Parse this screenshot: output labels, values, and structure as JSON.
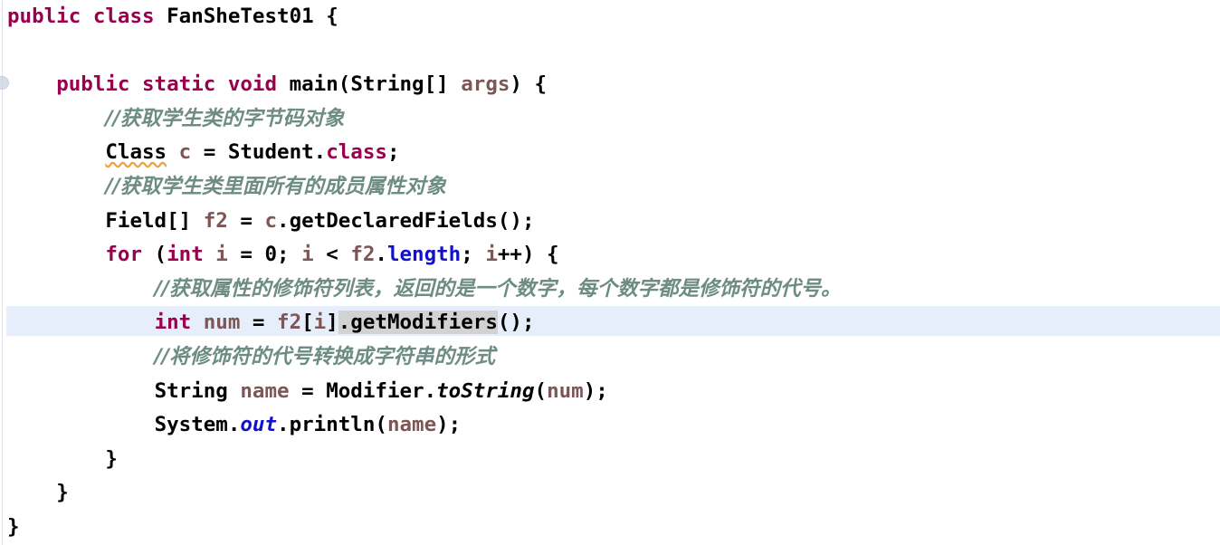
{
  "editor": {
    "language": "java",
    "class_name": "FanSheTest01",
    "font_size_px": 22,
    "line_height_px": 37,
    "background_color": "#ffffff",
    "caret_line_highlight_color": "#e7eefb",
    "usage_highlight_color": "#d2d2d2",
    "warning_squiggle_color": "#e8a33d",
    "gutter_marker": "breakpoint-gutter-icon",
    "highlighted_line_number": 10,
    "highlighted_token": ".getModifiers"
  },
  "palette": {
    "keyword": "#99004D",
    "comment": "#6D8C84",
    "identifier": "#7D5656",
    "static_field": "#1111CC",
    "instance_field": "#1111CC",
    "plain": "#000000"
  },
  "lines": [
    {
      "n": 1,
      "indent": 0,
      "tokens": [
        {
          "t": "public",
          "c": "kw"
        },
        {
          "t": " ",
          "c": "plain"
        },
        {
          "t": "class",
          "c": "kw"
        },
        {
          "t": " ",
          "c": "plain"
        },
        {
          "t": "FanSheTest01",
          "c": "plain"
        },
        {
          "t": " {",
          "c": "plain"
        }
      ]
    },
    {
      "n": 2,
      "indent": 0,
      "tokens": []
    },
    {
      "n": 3,
      "indent": 1,
      "tokens": [
        {
          "t": "public",
          "c": "kw"
        },
        {
          "t": " ",
          "c": "plain"
        },
        {
          "t": "static",
          "c": "kw"
        },
        {
          "t": " ",
          "c": "plain"
        },
        {
          "t": "void",
          "c": "kw"
        },
        {
          "t": " ",
          "c": "plain"
        },
        {
          "t": "main",
          "c": "plain"
        },
        {
          "t": "(",
          "c": "plain"
        },
        {
          "t": "String",
          "c": "plain"
        },
        {
          "t": "[] ",
          "c": "plain"
        },
        {
          "t": "args",
          "c": "id"
        },
        {
          "t": ") {",
          "c": "plain"
        }
      ]
    },
    {
      "n": 4,
      "indent": 2,
      "tokens": [
        {
          "t": "//获取学生类的字节码对象",
          "c": "cmt"
        }
      ]
    },
    {
      "n": 5,
      "indent": 2,
      "tokens": [
        {
          "t": "Class",
          "c": "plain warn"
        },
        {
          "t": " ",
          "c": "plain"
        },
        {
          "t": "c",
          "c": "id"
        },
        {
          "t": " = ",
          "c": "plain"
        },
        {
          "t": "Student",
          "c": "plain"
        },
        {
          "t": ".",
          "c": "plain"
        },
        {
          "t": "class",
          "c": "kw"
        },
        {
          "t": ";",
          "c": "plain"
        }
      ]
    },
    {
      "n": 6,
      "indent": 2,
      "tokens": [
        {
          "t": "//获取学生类里面所有的成员属性对象",
          "c": "cmt"
        }
      ]
    },
    {
      "n": 7,
      "indent": 2,
      "tokens": [
        {
          "t": "Field",
          "c": "plain"
        },
        {
          "t": "[] ",
          "c": "plain"
        },
        {
          "t": "f2",
          "c": "id"
        },
        {
          "t": " = ",
          "c": "plain"
        },
        {
          "t": "c",
          "c": "id"
        },
        {
          "t": ".getDeclaredFields();",
          "c": "plain"
        }
      ]
    },
    {
      "n": 8,
      "indent": 2,
      "tokens": [
        {
          "t": "for",
          "c": "kw"
        },
        {
          "t": " (",
          "c": "plain"
        },
        {
          "t": "int",
          "c": "kw"
        },
        {
          "t": " ",
          "c": "plain"
        },
        {
          "t": "i",
          "c": "id"
        },
        {
          "t": " = ",
          "c": "plain"
        },
        {
          "t": "0",
          "c": "num"
        },
        {
          "t": "; ",
          "c": "plain"
        },
        {
          "t": "i",
          "c": "id"
        },
        {
          "t": " < ",
          "c": "plain"
        },
        {
          "t": "f2",
          "c": "id"
        },
        {
          "t": ".",
          "c": "plain"
        },
        {
          "t": "length",
          "c": "fld"
        },
        {
          "t": "; ",
          "c": "plain"
        },
        {
          "t": "i",
          "c": "id"
        },
        {
          "t": "++) {",
          "c": "plain"
        }
      ]
    },
    {
      "n": 9,
      "indent": 3,
      "tokens": [
        {
          "t": "//获取属性的修饰符列表，返回的是一个数字，每个数字都是修饰符的代号。",
          "c": "cmt"
        }
      ]
    },
    {
      "n": 10,
      "indent": 3,
      "caret": true,
      "tokens": [
        {
          "t": "int",
          "c": "kw"
        },
        {
          "t": " ",
          "c": "plain"
        },
        {
          "t": "num",
          "c": "id"
        },
        {
          "t": " = ",
          "c": "plain"
        },
        {
          "t": "f2",
          "c": "id"
        },
        {
          "t": "[",
          "c": "plain"
        },
        {
          "t": "i",
          "c": "id"
        },
        {
          "t": "]",
          "c": "plain"
        },
        {
          "t": ".getModifiers",
          "c": "plain usage"
        },
        {
          "t": "();",
          "c": "plain"
        }
      ]
    },
    {
      "n": 11,
      "indent": 3,
      "tokens": [
        {
          "t": "//将修饰符的代号转换成字符串的形式",
          "c": "cmt"
        }
      ]
    },
    {
      "n": 12,
      "indent": 3,
      "tokens": [
        {
          "t": "String",
          "c": "plain"
        },
        {
          "t": " ",
          "c": "plain"
        },
        {
          "t": "name",
          "c": "id"
        },
        {
          "t": " = ",
          "c": "plain"
        },
        {
          "t": "Modifier",
          "c": "plain"
        },
        {
          "t": ".",
          "c": "plain"
        },
        {
          "t": "toString",
          "c": "smth"
        },
        {
          "t": "(",
          "c": "plain"
        },
        {
          "t": "num",
          "c": "id"
        },
        {
          "t": ");",
          "c": "plain"
        }
      ]
    },
    {
      "n": 13,
      "indent": 3,
      "tokens": [
        {
          "t": "System",
          "c": "plain"
        },
        {
          "t": ".",
          "c": "plain"
        },
        {
          "t": "out",
          "c": "sfld"
        },
        {
          "t": ".println(",
          "c": "plain"
        },
        {
          "t": "name",
          "c": "id"
        },
        {
          "t": ");",
          "c": "plain"
        }
      ]
    },
    {
      "n": 14,
      "indent": 2,
      "tokens": [
        {
          "t": "}",
          "c": "plain"
        }
      ]
    },
    {
      "n": 15,
      "indent": 1,
      "tokens": [
        {
          "t": "}",
          "c": "plain"
        }
      ]
    },
    {
      "n": 16,
      "indent": 0,
      "tokens": [
        {
          "t": "}",
          "c": "plain"
        }
      ]
    }
  ]
}
